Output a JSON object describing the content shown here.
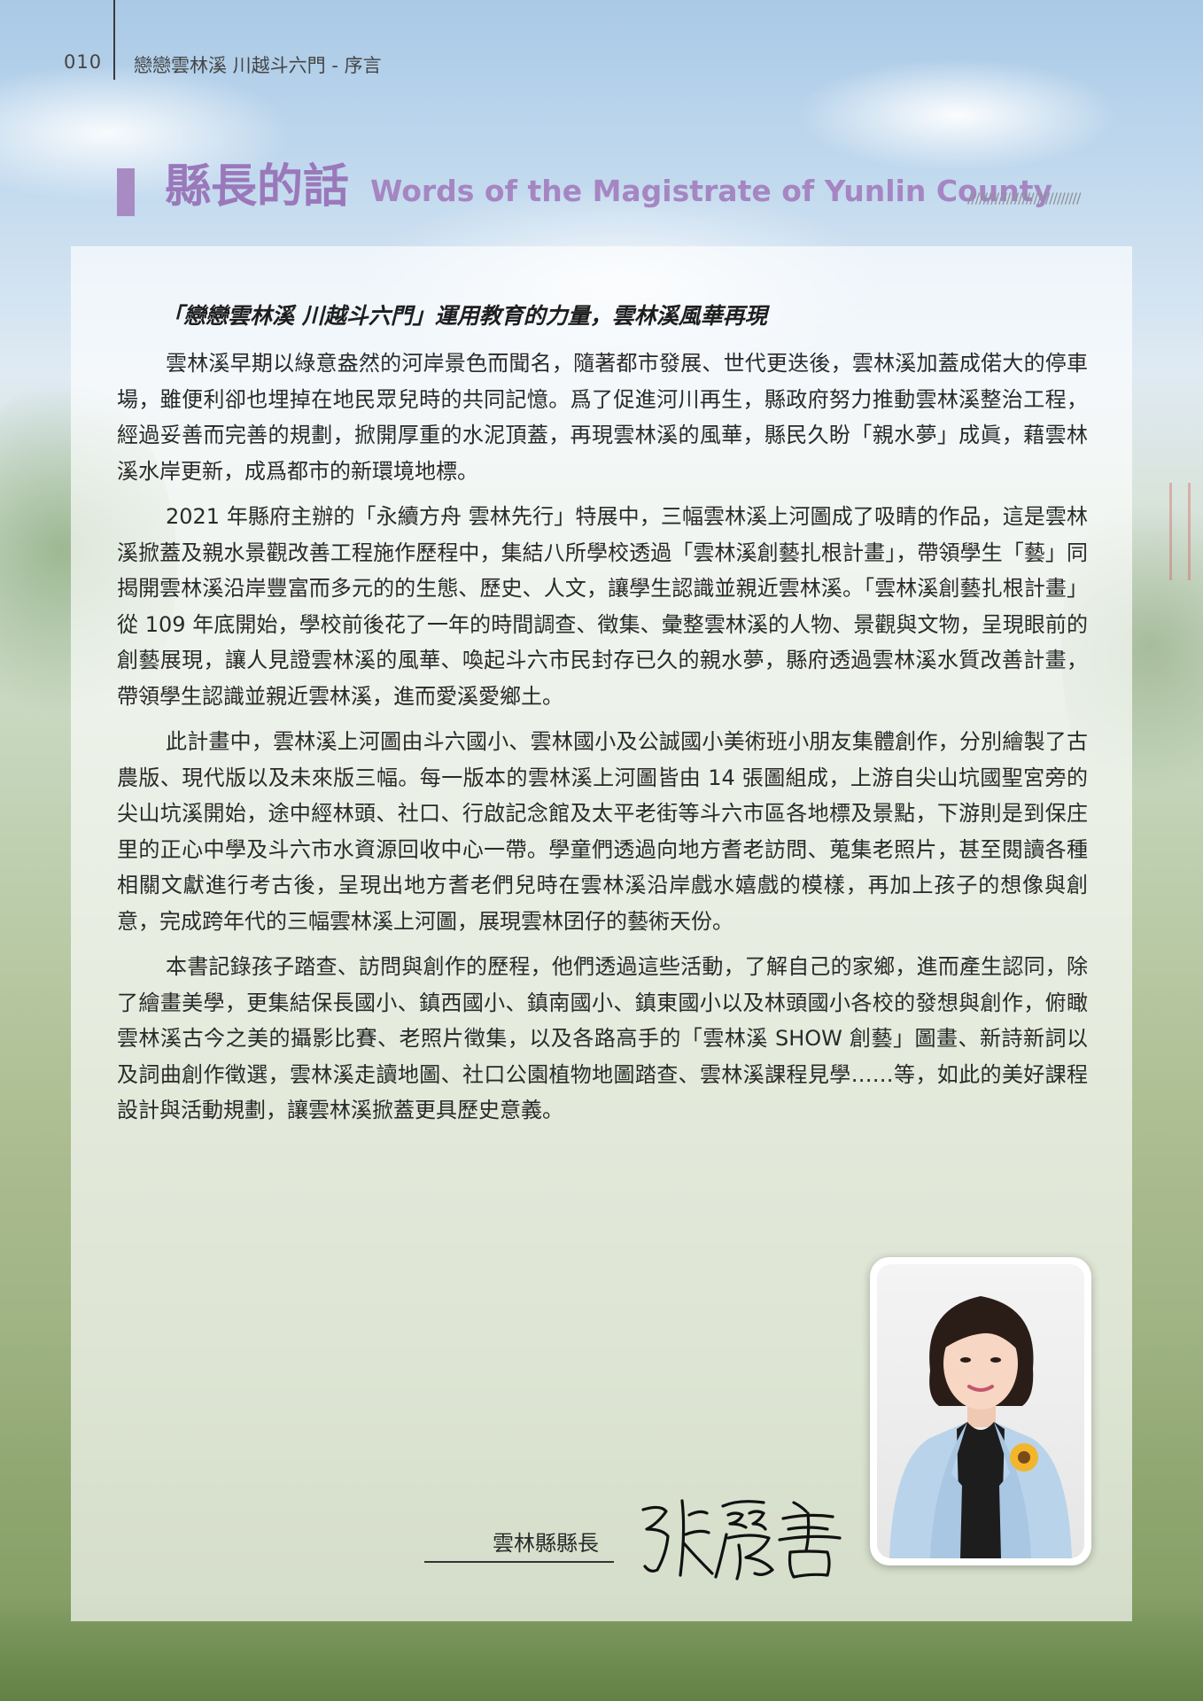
{
  "header": {
    "page_number": "010",
    "running_title": "戀戀雲林溪  川越斗六門 - 序言"
  },
  "section": {
    "title_zh": "縣長的話",
    "title_en": "Words of the Magistrate of Yunlin County",
    "hatch": "/////////////////////////////"
  },
  "article": {
    "subtitle": "「戀戀雲林溪 川越斗六門」運用教育的力量，雲林溪風華再現",
    "paragraphs": [
      "雲林溪早期以綠意盎然的河岸景色而聞名，隨著都市發展、世代更迭後，雲林溪加蓋成偌大的停車場，雖便利卻也埋掉在地民眾兒時的共同記憶。爲了促進河川再生，縣政府努力推動雲林溪整治工程，經過妥善而完善的規劃，掀開厚重的水泥頂蓋，再現雲林溪的風華，縣民久盼「親水夢」成眞，藉雲林溪水岸更新，成爲都市的新環境地標。",
      "2021 年縣府主辦的「永續方舟 雲林先行」特展中，三幅雲林溪上河圖成了吸睛的作品，這是雲林溪掀蓋及親水景觀改善工程施作歷程中，集結八所學校透過「雲林溪創藝扎根計畫」，帶領學生「藝」同揭開雲林溪沿岸豐富而多元的的生態、歷史、人文，讓學生認識並親近雲林溪。「雲林溪創藝扎根計畫」從 109 年底開始，學校前後花了一年的時間調查、徵集、彙整雲林溪的人物、景觀與文物，呈現眼前的創藝展現，讓人見證雲林溪的風華、喚起斗六市民封存已久的親水夢，縣府透過雲林溪水質改善計畫，帶領學生認識並親近雲林溪，進而愛溪愛鄉土。",
      "此計畫中，雲林溪上河圖由斗六國小、雲林國小及公誠國小美術班小朋友集體創作，分別繪製了古農版、現代版以及未來版三幅。每一版本的雲林溪上河圖皆由 14 張圖組成，上游自尖山坑國聖宮旁的尖山坑溪開始，途中經林頭、社口、行啟記念館及太平老街等斗六市區各地標及景點，下游則是到保庄里的正心中學及斗六市水資源回收中心一帶。學童們透過向地方耆老訪問、蒐集老照片，甚至閱讀各種相關文獻進行考古後，呈現出地方耆老們兒時在雲林溪沿岸戲水嬉戲的模樣，再加上孩子的想像與創意，完成跨年代的三幅雲林溪上河圖，展現雲林囝仔的藝術天份。",
      "本書記錄孩子踏查、訪問與創作的歷程，他們透過這些活動，了解自己的家鄉，進而產生認同，除了繪畫美學，更集結保長國小、鎮西國小、鎮南國小、鎮東國小以及林頭國小各校的發想與創作，俯瞰雲林溪古今之美的攝影比賽、老照片徵集，以及各路高手的「雲林溪 SHOW 創藝」圖畫、新詩新詞以及詞曲創作徵選，雲林溪走讀地圖、社口公園植物地圖踏查、雲林溪課程見學……等，如此的美好課程設計與活動規劃，讓雲林溪掀蓋更具歷史意義。"
    ]
  },
  "signoff": {
    "role": "雲林縣縣長",
    "signature_text": "張麗善"
  },
  "colors": {
    "accent": "#a98bc4",
    "title": "#9a78ba"
  }
}
